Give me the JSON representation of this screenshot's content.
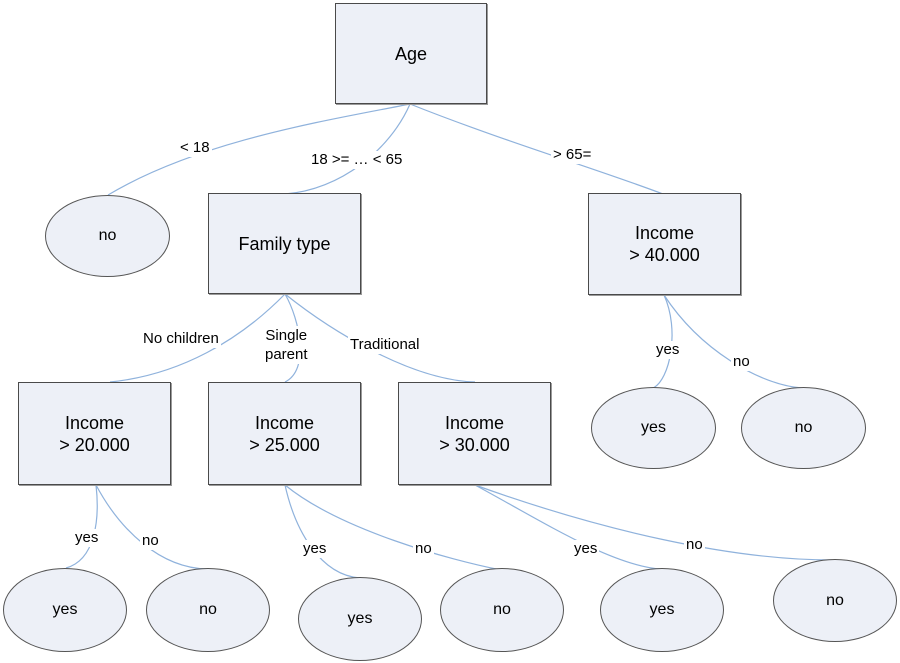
{
  "diagram": {
    "type": "decision-tree",
    "nodes": {
      "root": "Age",
      "age_lt18_leaf": "no",
      "family_type": "Family type",
      "income_40": "Income\n> 40.000",
      "income_40_yes_leaf": "yes",
      "income_40_no_leaf": "no",
      "income_20": "Income\n> 20.000",
      "income_25": "Income\n> 25.000",
      "income_30": "Income\n> 30.000",
      "income_20_yes_leaf": "yes",
      "income_20_no_leaf": "no",
      "income_25_yes_leaf": "yes",
      "income_25_no_leaf": "no",
      "income_30_yes_leaf": "yes",
      "income_30_no_leaf": "no"
    },
    "edge_labels": {
      "age_lt18": "< 18",
      "age_mid": "18 >= … < 65",
      "age_gt65": "> 65=",
      "no_children": "No children",
      "single_parent": "Single\nparent",
      "traditional": "Traditional",
      "income_40_yes": "yes",
      "income_40_no": "no",
      "income_20_yes": "yes",
      "income_20_no": "no",
      "income_25_yes": "yes",
      "income_25_no": "no",
      "income_30_yes": "yes",
      "income_30_no": "no"
    },
    "colors": {
      "node_fill": "#edf0f7",
      "edge": "#8fb2dc",
      "border": "#4a4a4a"
    }
  }
}
